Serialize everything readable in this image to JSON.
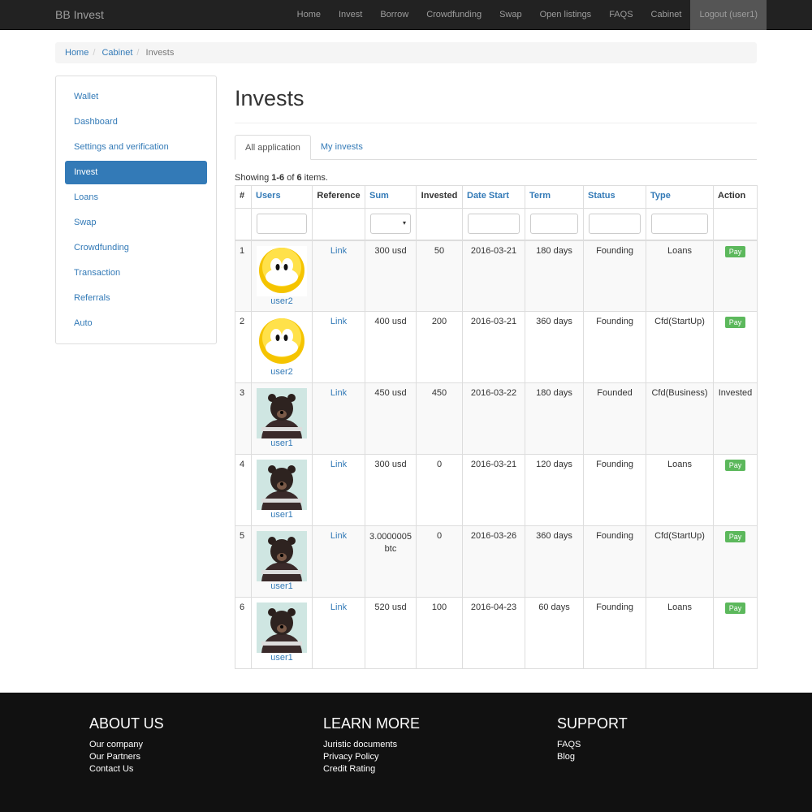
{
  "brand": "BB Invest",
  "nav": [
    "Home",
    "Invest",
    "Borrow",
    "Crowdfunding",
    "Swap",
    "Open listings",
    "FAQS",
    "Cabinet",
    "Logout (user1)"
  ],
  "breadcrumb": [
    "Home",
    "Cabinet",
    "Invests"
  ],
  "sidebar": [
    "Wallet",
    "Dashboard",
    "Settings and verification",
    "Invest",
    "Loans",
    "Swap",
    "Crowdfunding",
    "Transaction",
    "Referrals",
    "Auto"
  ],
  "page_title": "Invests",
  "tabs": [
    "All application",
    "My invests"
  ],
  "summary": {
    "pre": "Showing ",
    "range": "1-6",
    "mid": " of ",
    "total": "6",
    "post": " items."
  },
  "columns": [
    "#",
    "Users",
    "Reference",
    "Sum",
    "Invested",
    "Date Start",
    "Term",
    "Status",
    "Type",
    "Action"
  ],
  "rows": [
    {
      "n": "1",
      "user": "user2",
      "avatar": "smiley",
      "ref": "Link",
      "sum": "300 usd",
      "invested": "50",
      "date": "2016-03-21",
      "term": "180 days",
      "status": "Founding",
      "type": "Loans",
      "action": "Pay"
    },
    {
      "n": "2",
      "user": "user2",
      "avatar": "smiley",
      "ref": "Link",
      "sum": "400 usd",
      "invested": "200",
      "date": "2016-03-21",
      "term": "360 days",
      "status": "Founding",
      "type": "Cfd(StartUp)",
      "action": "Pay"
    },
    {
      "n": "3",
      "user": "user1",
      "avatar": "bear",
      "ref": "Link",
      "sum": "450 usd",
      "invested": "450",
      "date": "2016-03-22",
      "term": "180 days",
      "status": "Founded",
      "type": "Cfd(Business)",
      "action": "Invested"
    },
    {
      "n": "4",
      "user": "user1",
      "avatar": "bear",
      "ref": "Link",
      "sum": "300 usd",
      "invested": "0",
      "date": "2016-03-21",
      "term": "120 days",
      "status": "Founding",
      "type": "Loans",
      "action": "Pay"
    },
    {
      "n": "5",
      "user": "user1",
      "avatar": "bear",
      "ref": "Link",
      "sum": "3.0000005 btc",
      "invested": "0",
      "date": "2016-03-26",
      "term": "360 days",
      "status": "Founding",
      "type": "Cfd(StartUp)",
      "action": "Pay"
    },
    {
      "n": "6",
      "user": "user1",
      "avatar": "bear",
      "ref": "Link",
      "sum": "520 usd",
      "invested": "100",
      "date": "2016-04-23",
      "term": "60 days",
      "status": "Founding",
      "type": "Loans",
      "action": "Pay"
    }
  ],
  "footer": [
    {
      "title": "ABOUT US",
      "links": [
        "Our company",
        "Our Partners",
        "Contact Us"
      ]
    },
    {
      "title": "LEARN MORE",
      "links": [
        "Juristic documents",
        "Privacy Policy",
        "Credit Rating"
      ]
    },
    {
      "title": "SUPPORT",
      "links": [
        "FAQS",
        "Blog"
      ]
    }
  ]
}
